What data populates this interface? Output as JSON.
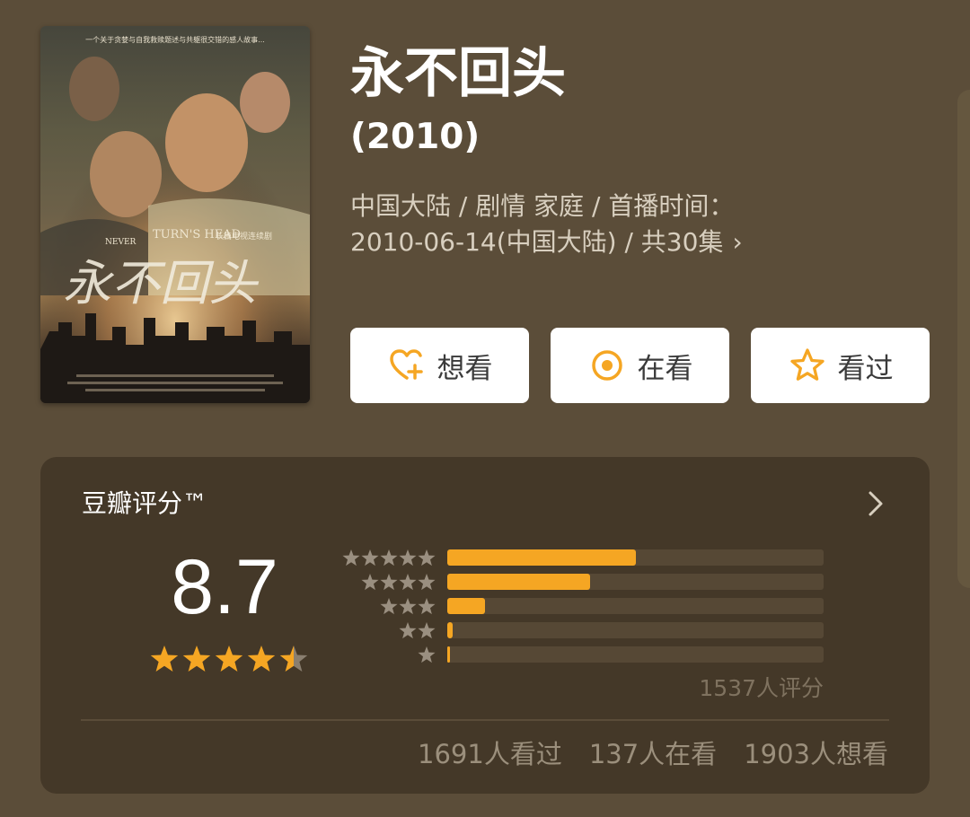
{
  "movie": {
    "title": "永不回头",
    "year": "(2010)",
    "meta_line1": "中国大陆 / 剧情 家庭 / 首播时间：",
    "meta_line2": "2010-06-14(中国大陆) / 共30集",
    "meta_chevron": "›",
    "poster": {
      "tagline": "一个关于贪婪与自我救赎题述与共躯很交错的感人故事...",
      "english_title": "TURN'S HEAD",
      "english_title_prefix": "NEVER",
      "subtitle": "长篇电视连续剧",
      "calligraphy_title": "永不回头"
    }
  },
  "actions": {
    "want": {
      "label": "想看",
      "icon": "heart-plus-icon"
    },
    "doing": {
      "label": "在看",
      "icon": "target-circle-icon"
    },
    "done": {
      "label": "看过",
      "icon": "star-outline-icon"
    }
  },
  "rating": {
    "title": "豆瓣评分™",
    "score": "8.7",
    "stars_out_of_5": 4.5,
    "distribution": [
      {
        "stars": 5,
        "fraction": 0.5
      },
      {
        "stars": 4,
        "fraction": 0.38
      },
      {
        "stars": 3,
        "fraction": 0.1
      },
      {
        "stars": 2,
        "fraction": 0.015
      },
      {
        "stars": 1,
        "fraction": 0.005
      }
    ],
    "count_label": "1537人评分",
    "stats": {
      "seen": "1691人看过",
      "watching": "137人在看",
      "want": "1903人想看"
    }
  },
  "colors": {
    "background": "#5b4d39",
    "card": "#443828",
    "accent": "#f5a623",
    "track": "#564835"
  }
}
